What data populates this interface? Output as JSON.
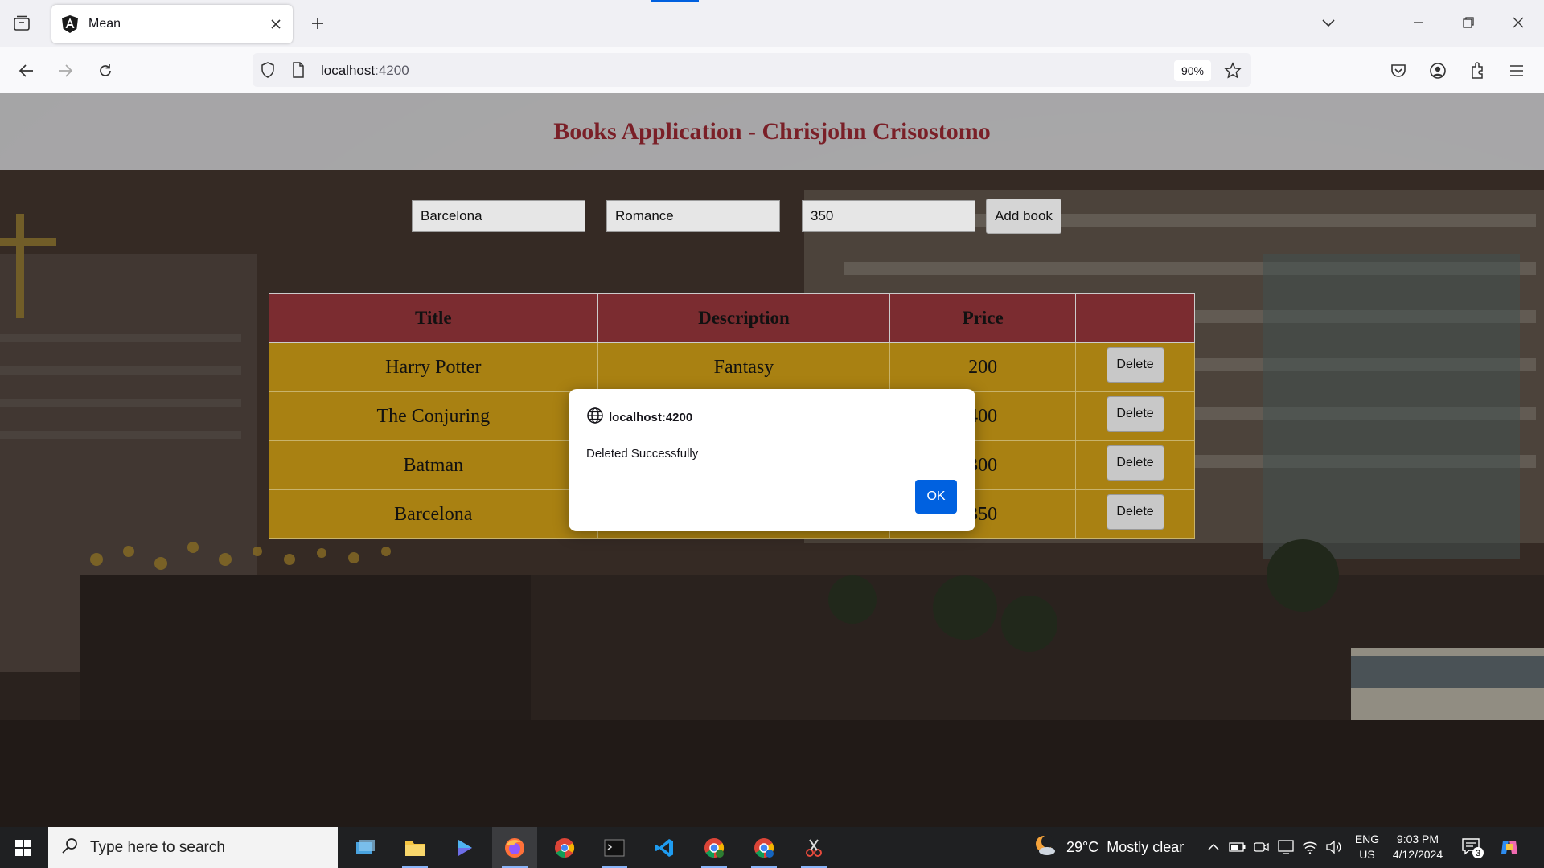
{
  "browser": {
    "tab_title": "Mean",
    "url_host": "localhost",
    "url_port": ":4200",
    "zoom": "90%"
  },
  "app": {
    "title": "Books Application - Chrisjohn Crisostomo",
    "form": {
      "title_value": "Barcelona",
      "description_value": "Romance",
      "price_value": "350",
      "add_label": "Add book"
    },
    "table": {
      "headers": [
        "Title",
        "Description",
        "Price",
        ""
      ],
      "rows": [
        {
          "title": "Harry Potter",
          "description": "Fantasy",
          "price": "200"
        },
        {
          "title": "The Conjuring",
          "description": "",
          "price": "400"
        },
        {
          "title": "Batman",
          "description": "",
          "price": "300"
        },
        {
          "title": "Barcelona",
          "description": "",
          "price": "350"
        }
      ],
      "delete_label": "Delete"
    }
  },
  "dialog": {
    "origin": "localhost:4200",
    "message": "Deleted Successfully",
    "ok_label": "OK"
  },
  "taskbar": {
    "search_placeholder": "Type here to search",
    "weather_temp": "29°C",
    "weather_desc": "Mostly clear",
    "lang_line1": "ENG",
    "lang_line2": "US",
    "time": "9:03 PM",
    "date": "4/12/2024",
    "notification_count": "3"
  },
  "colors": {
    "header_text": "#7a1f27",
    "table_header_bg": "#7b2c30",
    "table_row_bg": "#a98112",
    "dialog_button": "#0061e0"
  }
}
